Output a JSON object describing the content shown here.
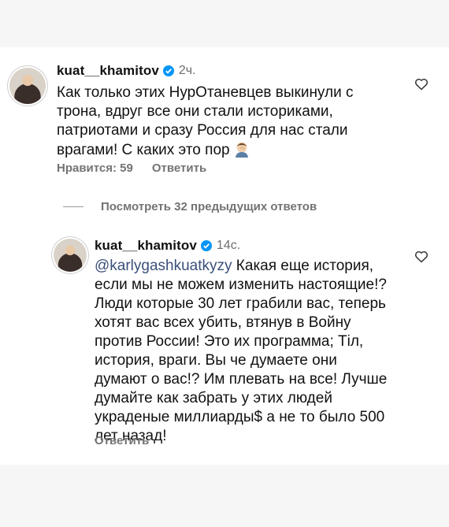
{
  "comments": [
    {
      "username": "kuat__khamitov",
      "time": "2ч.",
      "text_lines": [
        "Как только этих НурОтаневцев выкинули с",
        "трона, вдруг все они стали историками,",
        "патриотами и сразу Россия для нас стали",
        "врагами! С каких это пор"
      ],
      "emoji_icon": "man-facepalming-emoji",
      "likes": "Нравится: 59",
      "reply_label": "Ответить"
    },
    {
      "username": "kuat__khamitov",
      "time": "14с.",
      "mention": "@karlygashkuatkyzy",
      "text_first_rest": " Какая еще история,",
      "text_lines": [
        "если мы не можем изменить настоящие!?",
        "Люди которые 30 лет грабили вас, теперь",
        "хотят вас всех убить, втянув  в Войну",
        "против России! Это их программа; Тіл,",
        "история, враги. Вы че думаете они",
        "думают о вас!? Им плевать на все! Лучше",
        "думайте как забрать у этих людей",
        "украденые миллиарды$ а не то было 500",
        "лет назад!"
      ],
      "reply_label": "Ответить"
    }
  ],
  "view_replies": "Посмотреть 32 предыдущих ответов",
  "colors": {
    "verified": "#0095f6",
    "meta": "#737373",
    "mention": "#3a4f7a"
  }
}
